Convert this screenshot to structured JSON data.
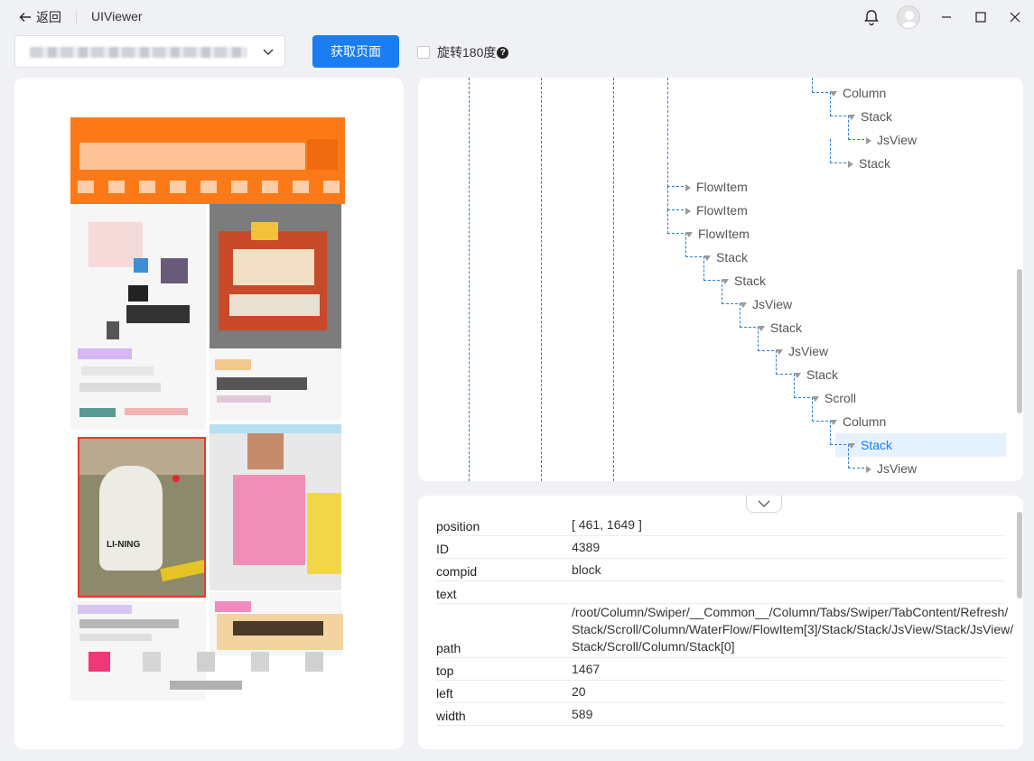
{
  "titlebar": {
    "back_label": "返回",
    "app_title": "UIViewer"
  },
  "toolbar": {
    "device_select_value": "",
    "fetch_label": "获取页面",
    "rotate_label": "旋转180度"
  },
  "device_preview": {
    "brand_text": "LI-NING"
  },
  "tree": {
    "nodes": [
      {
        "label": "Column",
        "expanded": true
      },
      {
        "label": "Stack",
        "expanded": true
      },
      {
        "label": "JsView",
        "expanded": false
      },
      {
        "label": "Stack",
        "expanded": false
      },
      {
        "label": "FlowItem",
        "expanded": false
      },
      {
        "label": "FlowItem",
        "expanded": false
      },
      {
        "label": "FlowItem",
        "expanded": true
      },
      {
        "label": "Stack",
        "expanded": true
      },
      {
        "label": "Stack",
        "expanded": true
      },
      {
        "label": "JsView",
        "expanded": true
      },
      {
        "label": "Stack",
        "expanded": true
      },
      {
        "label": "JsView",
        "expanded": true
      },
      {
        "label": "Stack",
        "expanded": true
      },
      {
        "label": "Scroll",
        "expanded": true
      },
      {
        "label": "Column",
        "expanded": true
      },
      {
        "label": "Stack",
        "expanded": true,
        "selected": true
      },
      {
        "label": "JsView",
        "expanded": false
      }
    ]
  },
  "attributes": [
    {
      "key": "position",
      "value": "[ 461, 1649 ]"
    },
    {
      "key": "ID",
      "value": "4389"
    },
    {
      "key": "compid",
      "value": "block"
    },
    {
      "key": "text",
      "value": ""
    },
    {
      "key": "path",
      "value": "/root/Column/Swiper/__Common__/Column/Tabs/Swiper/TabContent/Refresh/Stack/Scroll/Column/WaterFlow/FlowItem[3]/Stack/Stack/JsView/Stack/JsView/Stack/Scroll/Column/Stack[0]"
    },
    {
      "key": "top",
      "value": "1467"
    },
    {
      "key": "left",
      "value": "20"
    },
    {
      "key": "width",
      "value": "589"
    }
  ],
  "colors": {
    "accent": "#1a7df2",
    "tree_line": "#2f7fd0",
    "selection_bg": "#e5f1fd",
    "highlight_border": "#e53b2b",
    "app_header_orange": "#fb7a17"
  }
}
